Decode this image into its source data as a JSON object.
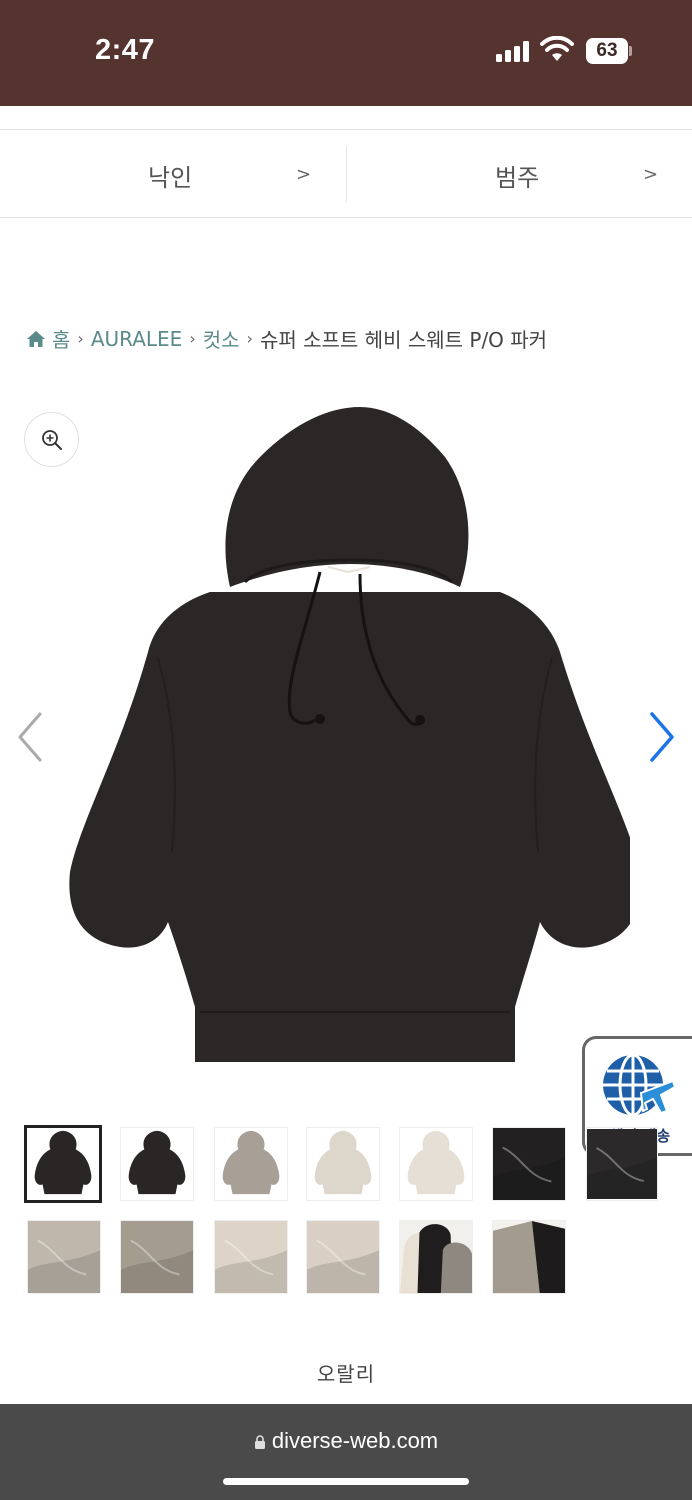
{
  "status_bar": {
    "time": "2:47",
    "battery": "63",
    "icons": [
      "signal-icon",
      "wifi-icon",
      "battery-icon"
    ]
  },
  "filters": [
    {
      "label": "낙인",
      "chevron": ">"
    },
    {
      "label": "범주",
      "chevron": ">"
    }
  ],
  "breadcrumb": {
    "home": "홈",
    "items": [
      "AURALEE",
      "컷소"
    ],
    "separator": "›",
    "current": "슈퍼 소프트 헤비 스웨트 P/O 파커"
  },
  "gallery": {
    "zoom_icon": "zoom-in-icon",
    "prev_icon": "chevron-left-icon",
    "next_icon": "chevron-right-icon",
    "main_color": "#2b2727"
  },
  "shipping_badge": {
    "label": "해외 배송",
    "icon": "globe-plane-icon",
    "color": "#1e5fa8"
  },
  "thumbnails": [
    {
      "color": "#2a2626",
      "kind": "hoodie-front",
      "active": true
    },
    {
      "color": "#2a2626",
      "kind": "hoodie-back",
      "active": false
    },
    {
      "color": "#a8a096",
      "kind": "hoodie-front",
      "active": false
    },
    {
      "color": "#ddd6cb",
      "kind": "hoodie-front",
      "active": false
    },
    {
      "color": "#e6dfd5",
      "kind": "hoodie-side",
      "active": false
    },
    {
      "color": "#222020",
      "kind": "detail",
      "active": false
    },
    {
      "color": "#2b2929",
      "kind": "detail",
      "active": false
    },
    {
      "color": "#bfb7ab",
      "kind": "detail",
      "active": false
    },
    {
      "color": "#a59c90",
      "kind": "detail",
      "active": false
    },
    {
      "color": "#ddd4c7",
      "kind": "detail",
      "active": false
    },
    {
      "color": "#d9cfc2",
      "kind": "detail",
      "active": false
    },
    {
      "color": "#8e8880",
      "kind": "group",
      "active": false
    },
    {
      "color": "#a49b8f",
      "kind": "group2",
      "active": false
    }
  ],
  "brand_label": "오랄리",
  "url_bar": {
    "url": "diverse-web.com"
  }
}
